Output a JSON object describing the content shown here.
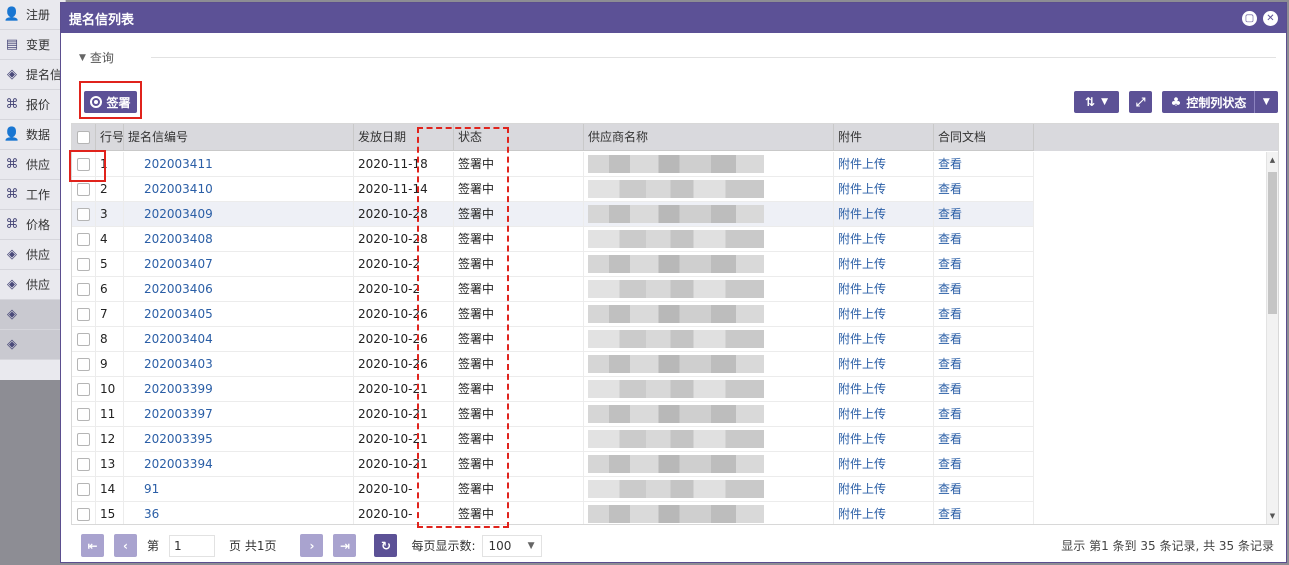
{
  "background_sidebar": {
    "items": [
      {
        "icon": "user-icon",
        "label": "注册"
      },
      {
        "icon": "doc-icon",
        "label": "变更"
      },
      {
        "icon": "layers-icon",
        "label": "提名信"
      },
      {
        "icon": "cmd-icon",
        "label": "报价"
      },
      {
        "icon": "user-icon",
        "label": "数据"
      },
      {
        "icon": "cmd-icon",
        "label": "供应"
      },
      {
        "icon": "cmd-icon",
        "label": "工作"
      },
      {
        "icon": "cmd-icon",
        "label": "价格"
      },
      {
        "icon": "layers-icon",
        "label": "供应"
      },
      {
        "icon": "layers-icon",
        "label": "供应"
      },
      {
        "icon": "layers-icon",
        "label": ""
      },
      {
        "icon": "layers-icon",
        "label": ""
      }
    ]
  },
  "modal": {
    "title": "提名信列表",
    "query_label": "查询",
    "sign_button": "签署",
    "col_state_button": "控制列状态"
  },
  "grid": {
    "headers": [
      "行号",
      "提名信编号",
      "发放日期",
      "状态",
      "供应商名称",
      "附件",
      "合同文档"
    ],
    "rows": [
      {
        "no": "1",
        "code": "202003411",
        "date": "2020-11-18",
        "state": "签署中",
        "attach": "附件上传",
        "doc": "查看"
      },
      {
        "no": "2",
        "code": "202003410",
        "date": "2020-11-14",
        "state": "签署中",
        "attach": "附件上传",
        "doc": "查看"
      },
      {
        "no": "3",
        "code": "202003409",
        "date": "2020-10-28",
        "state": "签署中",
        "attach": "附件上传",
        "doc": "查看"
      },
      {
        "no": "4",
        "code": "202003408",
        "date": "2020-10-28",
        "state": "签署中",
        "attach": "附件上传",
        "doc": "查看"
      },
      {
        "no": "5",
        "code": "202003407",
        "date": "2020-10-2",
        "state": "签署中",
        "attach": "附件上传",
        "doc": "查看"
      },
      {
        "no": "6",
        "code": "202003406",
        "date": "2020-10-2",
        "state": "签署中",
        "attach": "附件上传",
        "doc": "查看"
      },
      {
        "no": "7",
        "code": "202003405",
        "date": "2020-10-26",
        "state": "签署中",
        "attach": "附件上传",
        "doc": "查看"
      },
      {
        "no": "8",
        "code": "202003404",
        "date": "2020-10-26",
        "state": "签署中",
        "attach": "附件上传",
        "doc": "查看"
      },
      {
        "no": "9",
        "code": "202003403",
        "date": "2020-10-26",
        "state": "签署中",
        "attach": "附件上传",
        "doc": "查看"
      },
      {
        "no": "10",
        "code": "202003399",
        "date": "2020-10-21",
        "state": "签署中",
        "attach": "附件上传",
        "doc": "查看"
      },
      {
        "no": "11",
        "code": "202003397",
        "date": "2020-10-21",
        "state": "签署中",
        "attach": "附件上传",
        "doc": "查看"
      },
      {
        "no": "12",
        "code": "202003395",
        "date": "2020-10-21",
        "state": "签署中",
        "attach": "附件上传",
        "doc": "查看"
      },
      {
        "no": "13",
        "code": "202003394",
        "date": "2020-10-21",
        "state": "签署中",
        "attach": "附件上传",
        "doc": "查看"
      },
      {
        "no": "14",
        "code": "91",
        "date": "2020-10-",
        "state": "签署中",
        "attach": "附件上传",
        "doc": "查看"
      },
      {
        "no": "15",
        "code": "36",
        "date": "2020-10-",
        "state": "签署中",
        "attach": "附件上传",
        "doc": "查看"
      }
    ]
  },
  "pager": {
    "page_prefix": "第",
    "page_value": "1",
    "page_suffix": "页 共1页",
    "per_page_label": "每页显示数:",
    "per_page_value": "100",
    "status": "显示 第1 条到 35 条记录, 共 35 条记录"
  },
  "colors": {
    "accent": "#5c5196",
    "highlight": "#e0231c",
    "link": "#2a5ea6"
  }
}
